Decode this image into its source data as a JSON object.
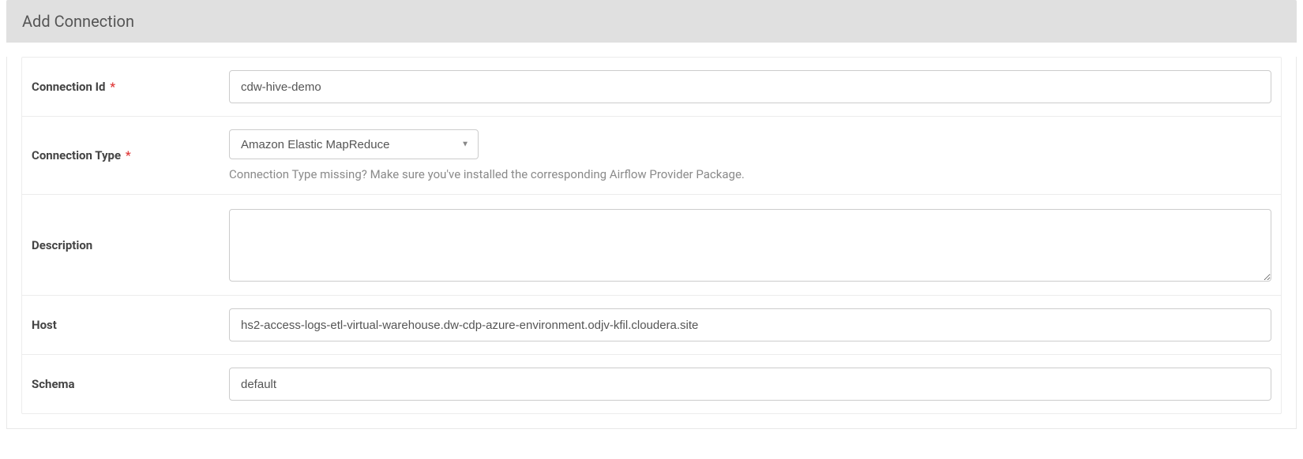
{
  "header": {
    "title": "Add Connection"
  },
  "form": {
    "labels": {
      "connectionId": "Connection Id",
      "connectionType": "Connection Type",
      "description": "Description",
      "host": "Host",
      "schema": "Schema"
    },
    "required_marker": "*",
    "values": {
      "connectionId": "cdw-hive-demo",
      "connectionType": "Amazon Elastic MapReduce",
      "description": "",
      "host": "hs2-access-logs-etl-virtual-warehouse.dw-cdp-azure-environment.odjv-kfil.cloudera.site",
      "schema": "default"
    },
    "help": {
      "connectionType": "Connection Type missing? Make sure you've installed the corresponding Airflow Provider Package."
    }
  }
}
